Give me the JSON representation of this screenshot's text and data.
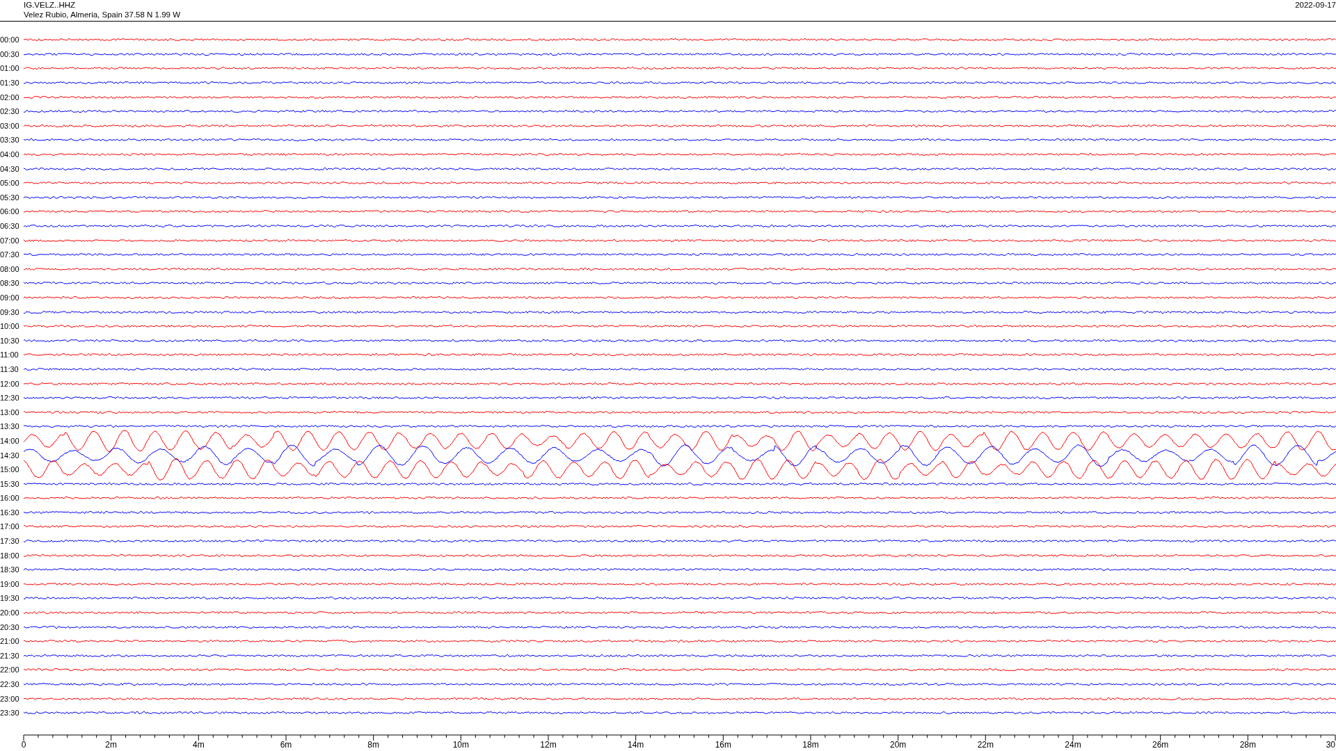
{
  "header": {
    "station": "IG.VELZ..HHZ",
    "location": "Velez Rubio, Almeria, Spain  37.58 N 1.99 W",
    "date": "2022-09-17"
  },
  "rows": [
    {
      "label": "00:00",
      "color": "#ff0000",
      "kind": "quiet"
    },
    {
      "label": "00:30",
      "color": "#0000ff",
      "kind": "quiet"
    },
    {
      "label": "01:00",
      "color": "#ff0000",
      "kind": "quiet"
    },
    {
      "label": "01:30",
      "color": "#0000ff",
      "kind": "quiet"
    },
    {
      "label": "02:00",
      "color": "#ff0000",
      "kind": "quiet"
    },
    {
      "label": "02:30",
      "color": "#0000ff",
      "kind": "quiet"
    },
    {
      "label": "03:00",
      "color": "#ff0000",
      "kind": "quiet"
    },
    {
      "label": "03:30",
      "color": "#0000ff",
      "kind": "quiet"
    },
    {
      "label": "04:00",
      "color": "#ff0000",
      "kind": "quiet"
    },
    {
      "label": "04:30",
      "color": "#0000ff",
      "kind": "quiet"
    },
    {
      "label": "05:00",
      "color": "#ff0000",
      "kind": "quiet"
    },
    {
      "label": "05:30",
      "color": "#0000ff",
      "kind": "quiet"
    },
    {
      "label": "06:00",
      "color": "#ff0000",
      "kind": "quiet"
    },
    {
      "label": "06:30",
      "color": "#0000ff",
      "kind": "quiet"
    },
    {
      "label": "07:00",
      "color": "#ff0000",
      "kind": "quiet"
    },
    {
      "label": "07:30",
      "color": "#0000ff",
      "kind": "quiet"
    },
    {
      "label": "08:00",
      "color": "#ff0000",
      "kind": "quiet"
    },
    {
      "label": "08:30",
      "color": "#0000ff",
      "kind": "quiet"
    },
    {
      "label": "09:00",
      "color": "#ff0000",
      "kind": "quiet"
    },
    {
      "label": "09:30",
      "color": "#0000ff",
      "kind": "quiet"
    },
    {
      "label": "10:00",
      "color": "#ff0000",
      "kind": "quiet"
    },
    {
      "label": "10:30",
      "color": "#0000ff",
      "kind": "quiet"
    },
    {
      "label": "11:00",
      "color": "#ff0000",
      "kind": "quiet"
    },
    {
      "label": "11:30",
      "color": "#0000ff",
      "kind": "quiet"
    },
    {
      "label": "12:00",
      "color": "#ff0000",
      "kind": "quiet"
    },
    {
      "label": "12:30",
      "color": "#0000ff",
      "kind": "quiet"
    },
    {
      "label": "13:00",
      "color": "#ff0000",
      "kind": "quiet"
    },
    {
      "label": "13:30",
      "color": "#0000ff",
      "kind": "quiet"
    },
    {
      "label": "14:00",
      "color": "#ff0000",
      "kind": "strong"
    },
    {
      "label": "14:30",
      "color": "#0000ff",
      "kind": "strong"
    },
    {
      "label": "15:00",
      "color": "#ff0000",
      "kind": "strong"
    },
    {
      "label": "15:30",
      "color": "#0000ff",
      "kind": "quiet"
    },
    {
      "label": "16:00",
      "color": "#ff0000",
      "kind": "quiet"
    },
    {
      "label": "16:30",
      "color": "#0000ff",
      "kind": "quiet"
    },
    {
      "label": "17:00",
      "color": "#ff0000",
      "kind": "quiet"
    },
    {
      "label": "17:30",
      "color": "#0000ff",
      "kind": "quiet"
    },
    {
      "label": "18:00",
      "color": "#ff0000",
      "kind": "quiet"
    },
    {
      "label": "18:30",
      "color": "#0000ff",
      "kind": "quiet"
    },
    {
      "label": "19:00",
      "color": "#ff0000",
      "kind": "quiet"
    },
    {
      "label": "19:30",
      "color": "#0000ff",
      "kind": "quiet"
    },
    {
      "label": "20:00",
      "color": "#ff0000",
      "kind": "quiet"
    },
    {
      "label": "20:30",
      "color": "#0000ff",
      "kind": "quiet"
    },
    {
      "label": "21:00",
      "color": "#ff0000",
      "kind": "quiet"
    },
    {
      "label": "21:30",
      "color": "#0000ff",
      "kind": "quiet"
    },
    {
      "label": "22:00",
      "color": "#ff0000",
      "kind": "quiet"
    },
    {
      "label": "22:30",
      "color": "#0000ff",
      "kind": "quiet"
    },
    {
      "label": "23:00",
      "color": "#ff0000",
      "kind": "quiet"
    },
    {
      "label": "23:30",
      "color": "#0000ff",
      "kind": "quiet"
    }
  ],
  "x_axis": {
    "tick_labels": [
      "0",
      "2m",
      "4m",
      "6m",
      "8m",
      "10m",
      "12m",
      "14m",
      "16m",
      "18m",
      "20m",
      "22m",
      "24m",
      "26m",
      "28m",
      "30"
    ]
  }
}
